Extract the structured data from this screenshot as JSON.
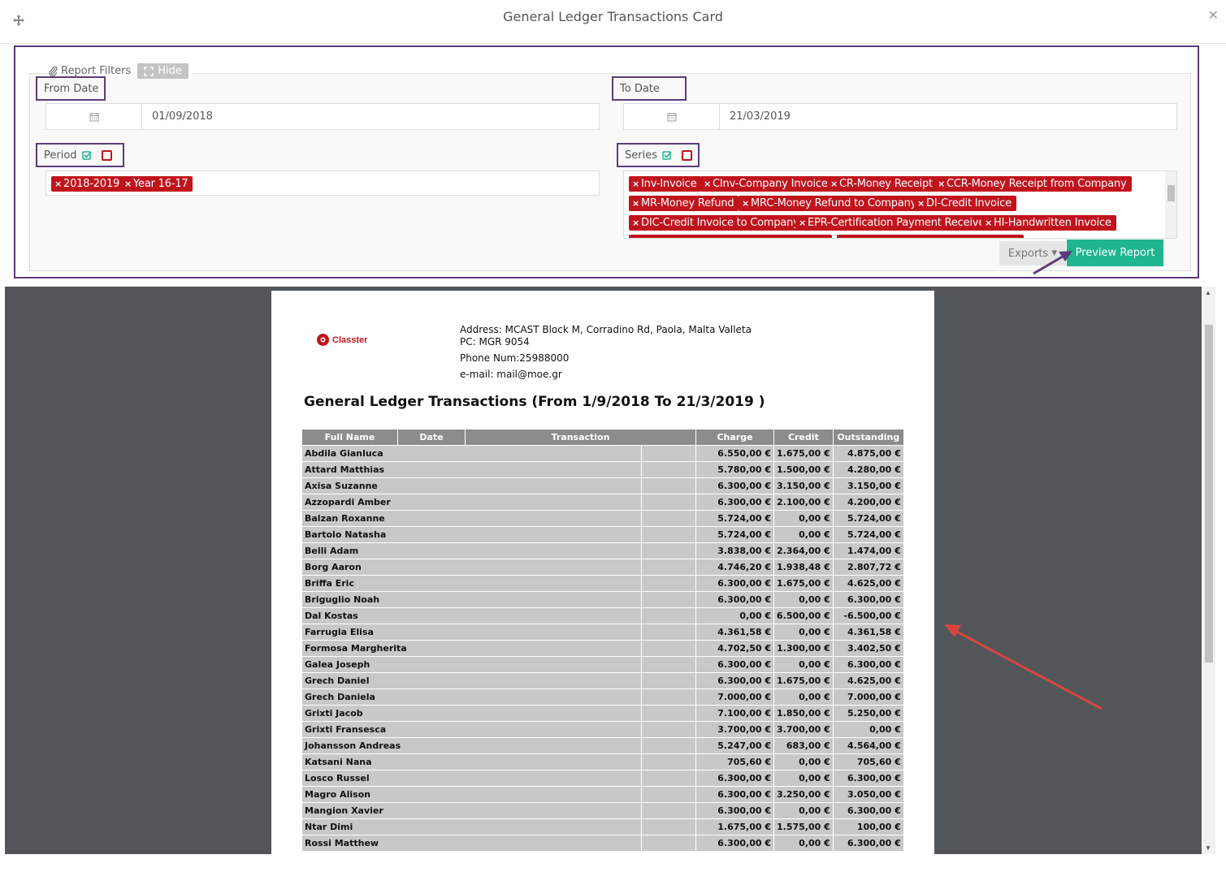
{
  "modal": {
    "title": "General Ledger Transactions Card",
    "close": "✕"
  },
  "filters": {
    "legend": "Report Filters",
    "hide_label": "Hide",
    "from_date": {
      "label": "From Date",
      "value": "01/09/2018"
    },
    "to_date": {
      "label": "To Date",
      "value": "21/03/2019"
    },
    "period": {
      "label": "Period",
      "tags": [
        "2018-2019",
        "Year 16-17"
      ]
    },
    "series": {
      "label": "Series",
      "tags": [
        "Inv-Invoice",
        "CInv-Company Invoice",
        "CR-Money Receipt",
        "CCR-Money Receipt from Company",
        "MR-Money Refund",
        "MRC-Money Refund to Company",
        "DI-Credit Invoice",
        "DIC-Credit Invoice to Company",
        "EPR-Certification Payment Receive",
        "HI-Handwritten Invoice"
      ]
    },
    "exports_label": "Exports",
    "preview_label": "Preview Report"
  },
  "report": {
    "logo_text": "Classter",
    "address_line1": "Address: MCAST Block M, Corradino Rd, Paola, Malta  Valleta",
    "address_line2": "PC: MGR 9054",
    "phone": "Phone Num:25988000",
    "email": "e-mail: mail@moe.gr",
    "title": "General Ledger Transactions (From 1/9/2018 To 21/3/2019 )",
    "columns": [
      "Full Name",
      "Date",
      "Transaction",
      "Charge",
      "Credit",
      "Outstanding"
    ],
    "rows": [
      {
        "name": "Abdila Gianluca",
        "charge": "6.550,00 €",
        "credit": "1.675,00 €",
        "outstanding": "4.875,00 €"
      },
      {
        "name": "Attard Matthias",
        "charge": "5.780,00 €",
        "credit": "1.500,00 €",
        "outstanding": "4.280,00 €"
      },
      {
        "name": "Axisa Suzanne",
        "charge": "6.300,00 €",
        "credit": "3.150,00 €",
        "outstanding": "3.150,00 €"
      },
      {
        "name": "Azzopardi Amber",
        "charge": "6.300,00 €",
        "credit": "2.100,00 €",
        "outstanding": "4.200,00 €"
      },
      {
        "name": "Balzan Roxanne",
        "charge": "5.724,00 €",
        "credit": "0,00 €",
        "outstanding": "5.724,00 €"
      },
      {
        "name": "Bartolo Natasha",
        "charge": "5.724,00 €",
        "credit": "0,00 €",
        "outstanding": "5.724,00 €"
      },
      {
        "name": "Belli Adam",
        "charge": "3.838,00 €",
        "credit": "2.364,00 €",
        "outstanding": "1.474,00 €"
      },
      {
        "name": "Borg Aaron",
        "charge": "4.746,20 €",
        "credit": "1.938,48 €",
        "outstanding": "2.807,72 €"
      },
      {
        "name": "Briffa Eric",
        "charge": "6.300,00 €",
        "credit": "1.675,00 €",
        "outstanding": "4.625,00 €"
      },
      {
        "name": "Briguglio Noah",
        "charge": "6.300,00 €",
        "credit": "0,00 €",
        "outstanding": "6.300,00 €"
      },
      {
        "name": "Dal Kostas",
        "charge": "0,00 €",
        "credit": "6.500,00 €",
        "outstanding": "-6.500,00 €"
      },
      {
        "name": "Farrugia Elisa",
        "charge": "4.361,58 €",
        "credit": "0,00 €",
        "outstanding": "4.361,58 €"
      },
      {
        "name": "Formosa Margherita",
        "charge": "4.702,50 €",
        "credit": "1.300,00 €",
        "outstanding": "3.402,50 €"
      },
      {
        "name": "Galea Joseph",
        "charge": "6.300,00 €",
        "credit": "0,00 €",
        "outstanding": "6.300,00 €"
      },
      {
        "name": "Grech Daniel",
        "charge": "6.300,00 €",
        "credit": "1.675,00 €",
        "outstanding": "4.625,00 €"
      },
      {
        "name": "Grech Daniela",
        "charge": "7.000,00 €",
        "credit": "0,00 €",
        "outstanding": "7.000,00 €"
      },
      {
        "name": "Grixti  Jacob",
        "charge": "7.100,00 €",
        "credit": "1.850,00 €",
        "outstanding": "5.250,00 €"
      },
      {
        "name": "Grixti Fransesca",
        "charge": "3.700,00 €",
        "credit": "3.700,00 €",
        "outstanding": "0,00 €"
      },
      {
        "name": "Johansson Andreas",
        "charge": "5.247,00 €",
        "credit": "683,00 €",
        "outstanding": "4.564,00 €"
      },
      {
        "name": "Katsani Nana",
        "charge": "705,60 €",
        "credit": "0,00 €",
        "outstanding": "705,60 €"
      },
      {
        "name": "Losco Russel",
        "charge": "6.300,00 €",
        "credit": "0,00 €",
        "outstanding": "6.300,00 €"
      },
      {
        "name": "Magro Alison",
        "charge": "6.300,00 €",
        "credit": "3.250,00 €",
        "outstanding": "3.050,00 €"
      },
      {
        "name": "Mangion Xavier",
        "charge": "6.300,00 €",
        "credit": "0,00 €",
        "outstanding": "6.300,00 €"
      },
      {
        "name": "Ntar Dimi",
        "charge": "1.675,00 €",
        "credit": "1.575,00 €",
        "outstanding": "100,00 €"
      },
      {
        "name": "Rossi Matthew",
        "charge": "6.300,00 €",
        "credit": "0,00 €",
        "outstanding": "6.300,00 €"
      }
    ]
  },
  "colors": {
    "tag_red": "#c0141d",
    "preview_green": "#1fb58f",
    "annotation_purple": "#5a3d7a",
    "arrow_red": "#d9463f"
  }
}
